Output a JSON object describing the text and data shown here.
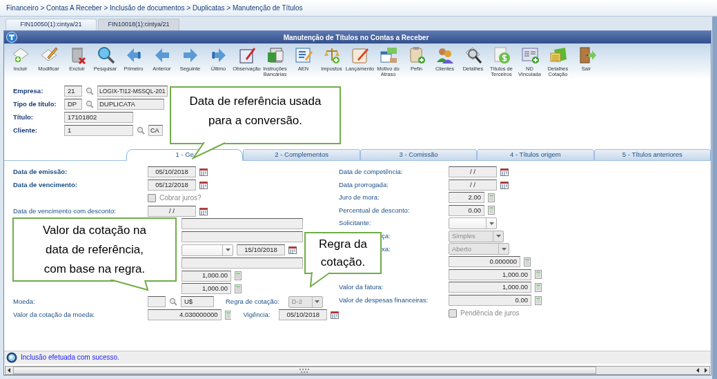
{
  "breadcrumb": "Financeiro > Contas A Receber > Inclusão de documentos > Duplicatas > Manutenção de Títulos",
  "window_tabs": [
    {
      "label": "FIN10050(1):cintya/21",
      "selected": true
    },
    {
      "label": "FIN10018(1):cintya/21",
      "selected": false
    }
  ],
  "window": {
    "title": "Manutenção de Títulos no Contas a Receber"
  },
  "toolbar": [
    "Incluir",
    "Modificar",
    "Excluir",
    "Pesquisar",
    "Primeiro",
    "Anterior",
    "Seguinte",
    "Último",
    "Observação",
    "Instruções\nBancárias",
    "AEN",
    "Impostos",
    "Lançamento",
    "Motivo do\nAtraso",
    "Pefin",
    "Clientes",
    "Detalhes",
    "Títulos de\nTerceiros",
    "ND\nVinculada",
    "Detalhes\nCotação",
    "Sair"
  ],
  "header_fields": [
    {
      "label": "Empresa:",
      "controls": [
        {
          "kind": "text",
          "value": "21"
        },
        {
          "kind": "lookup"
        },
        {
          "kind": "text",
          "value": "LOGIX-TI12-MSSQL-201"
        }
      ]
    },
    {
      "label": "Tipo de título:",
      "controls": [
        {
          "kind": "text",
          "value": "DP"
        },
        {
          "kind": "lookup"
        },
        {
          "kind": "text",
          "value": "DUPLICATA"
        }
      ]
    },
    {
      "label": "Título:",
      "controls": [
        {
          "kind": "text",
          "value": "17101802"
        }
      ]
    },
    {
      "label": "Cliente:",
      "controls": [
        {
          "kind": "text",
          "value": "1"
        },
        {
          "kind": "lookup"
        },
        {
          "kind": "text",
          "value": "CA"
        }
      ]
    }
  ],
  "form_tabs": [
    {
      "label": "1 - Ge",
      "selected": true
    },
    {
      "label": "2 - Complementos",
      "selected": false
    },
    {
      "label": "3 - Comissão",
      "selected": false
    },
    {
      "label": "4 - Títulos origem",
      "selected": false
    },
    {
      "label": "5 - Títulos anteriores",
      "selected": false
    }
  ],
  "left_fields": [
    {
      "label": "Data de emissão:",
      "bold": true,
      "controls": [
        {
          "kind": "date",
          "value": "05/10/2018"
        },
        {
          "kind": "calendar"
        }
      ]
    },
    {
      "label": "Data de vencimento:",
      "bold": true,
      "controls": [
        {
          "kind": "date",
          "value": "05/12/2018"
        },
        {
          "kind": "calendar"
        }
      ]
    },
    {
      "controls": [
        {
          "kind": "checkbox",
          "label": "Cobrar juros?",
          "checked": false,
          "disabled": true
        }
      ]
    },
    {
      "label": "Data de vencimento com desconto:",
      "bold": false,
      "controls": [
        {
          "kind": "date",
          "value": "/ /"
        },
        {
          "kind": "calendar"
        }
      ]
    },
    {
      "controls": [
        {
          "kind": "text"
        }
      ]
    },
    {
      "controls": [
        {
          "kind": "text"
        }
      ]
    },
    {
      "controls": [
        {
          "kind": "dropdown",
          "disabled": false
        },
        {
          "kind": "date",
          "value": "15/10/2018"
        },
        {
          "kind": "calendar"
        }
      ]
    },
    {
      "controls": [
        {
          "kind": "text"
        }
      ]
    },
    {
      "controls": [
        {
          "kind": "number",
          "value": "1,000.00"
        },
        {
          "kind": "calculator"
        }
      ]
    },
    {
      "controls": [
        {
          "kind": "number",
          "value": "1,000.00"
        },
        {
          "kind": "calculator"
        }
      ]
    },
    {
      "label": "Moeda:",
      "bold": false,
      "controls": [
        {
          "kind": "text"
        },
        {
          "kind": "lookup"
        },
        {
          "kind": "text",
          "value": "U$"
        },
        {
          "kind": "label",
          "value": "Regra de cotação:"
        },
        {
          "kind": "dropdown",
          "value": "D-2",
          "disabled": true
        }
      ]
    },
    {
      "label": "Valor da cotação da moeda:",
      "bold": false,
      "controls": [
        {
          "kind": "number",
          "value": "4.030000000"
        },
        {
          "kind": "calculator"
        },
        {
          "kind": "label",
          "value": "Vigência:"
        },
        {
          "kind": "date",
          "value": "05/10/2018"
        },
        {
          "kind": "calendar"
        }
      ]
    }
  ],
  "right_fields": [
    {
      "label": "Data de competência:",
      "controls": [
        {
          "kind": "date",
          "value": "/ /"
        },
        {
          "kind": "calendar"
        }
      ]
    },
    {
      "label": "Data prorrogada:",
      "controls": [
        {
          "kind": "date",
          "value": "/ /"
        },
        {
          "kind": "calendar"
        }
      ]
    },
    {
      "label": "Juro de mora:",
      "controls": [
        {
          "kind": "number",
          "value": "2.00"
        },
        {
          "kind": "calculator"
        }
      ]
    },
    {
      "label": "Percentual de desconto:",
      "controls": [
        {
          "kind": "number",
          "value": "0.00"
        },
        {
          "kind": "calculator"
        }
      ]
    },
    {
      "label": "Solicitante:",
      "controls": [
        {
          "kind": "dropdown",
          "disabled": false
        }
      ]
    },
    {
      "label": "ça:",
      "controls": [
        {
          "kind": "dropdown",
          "value": "Simples",
          "disabled": true
        }
      ]
    },
    {
      "label": "xa:",
      "controls": [
        {
          "kind": "dropdown",
          "value": "Aberto",
          "disabled": true
        }
      ]
    },
    {
      "controls": [
        {
          "kind": "number",
          "value": "0.000000"
        },
        {
          "kind": "calculator"
        }
      ]
    },
    {
      "controls": [
        {
          "kind": "number",
          "value": "1,000.00"
        },
        {
          "kind": "calculator"
        }
      ]
    },
    {
      "label": "Valor da fatura:",
      "controls": [
        {
          "kind": "number",
          "value": "1,000.00"
        },
        {
          "kind": "calculator"
        }
      ]
    },
    {
      "label": "Valor de despesas financeiras:",
      "controls": [
        {
          "kind": "number",
          "value": "0.00"
        },
        {
          "kind": "calculator"
        }
      ]
    },
    {
      "controls": [
        {
          "kind": "checkbox",
          "label": "Pendência de juros",
          "checked": false,
          "disabled": true
        }
      ]
    }
  ],
  "status_bar": {
    "message": "Inclusão efetuada com sucesso."
  },
  "callouts": [
    {
      "text": "Data de referência usada\npara a conversão."
    },
    {
      "text": "Valor da cotação na\ndata de referência,\ncom base na regra."
    },
    {
      "text": "Regra da\ncotação."
    }
  ]
}
